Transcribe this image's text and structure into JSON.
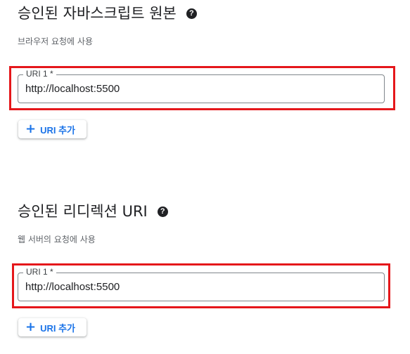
{
  "origins": {
    "title": "승인된 자바스크립트 원본",
    "help_icon": "question-circle-icon",
    "description": "브라우저 요청에 사용",
    "field_label": "URI 1 *",
    "field_value": "http://localhost:5500",
    "add_button_label": "URI 추가",
    "add_icon": "plus-icon"
  },
  "redirects": {
    "title": "승인된 리디렉션 URI",
    "help_icon": "question-circle-icon",
    "description": "웹 서버의 요청에 사용",
    "field_label": "URI 1 *",
    "field_value": "http://localhost:5500",
    "add_button_label": "URI 추가",
    "add_icon": "plus-icon"
  },
  "colors": {
    "accent": "#1a73e8",
    "highlight": "#e5171b"
  }
}
